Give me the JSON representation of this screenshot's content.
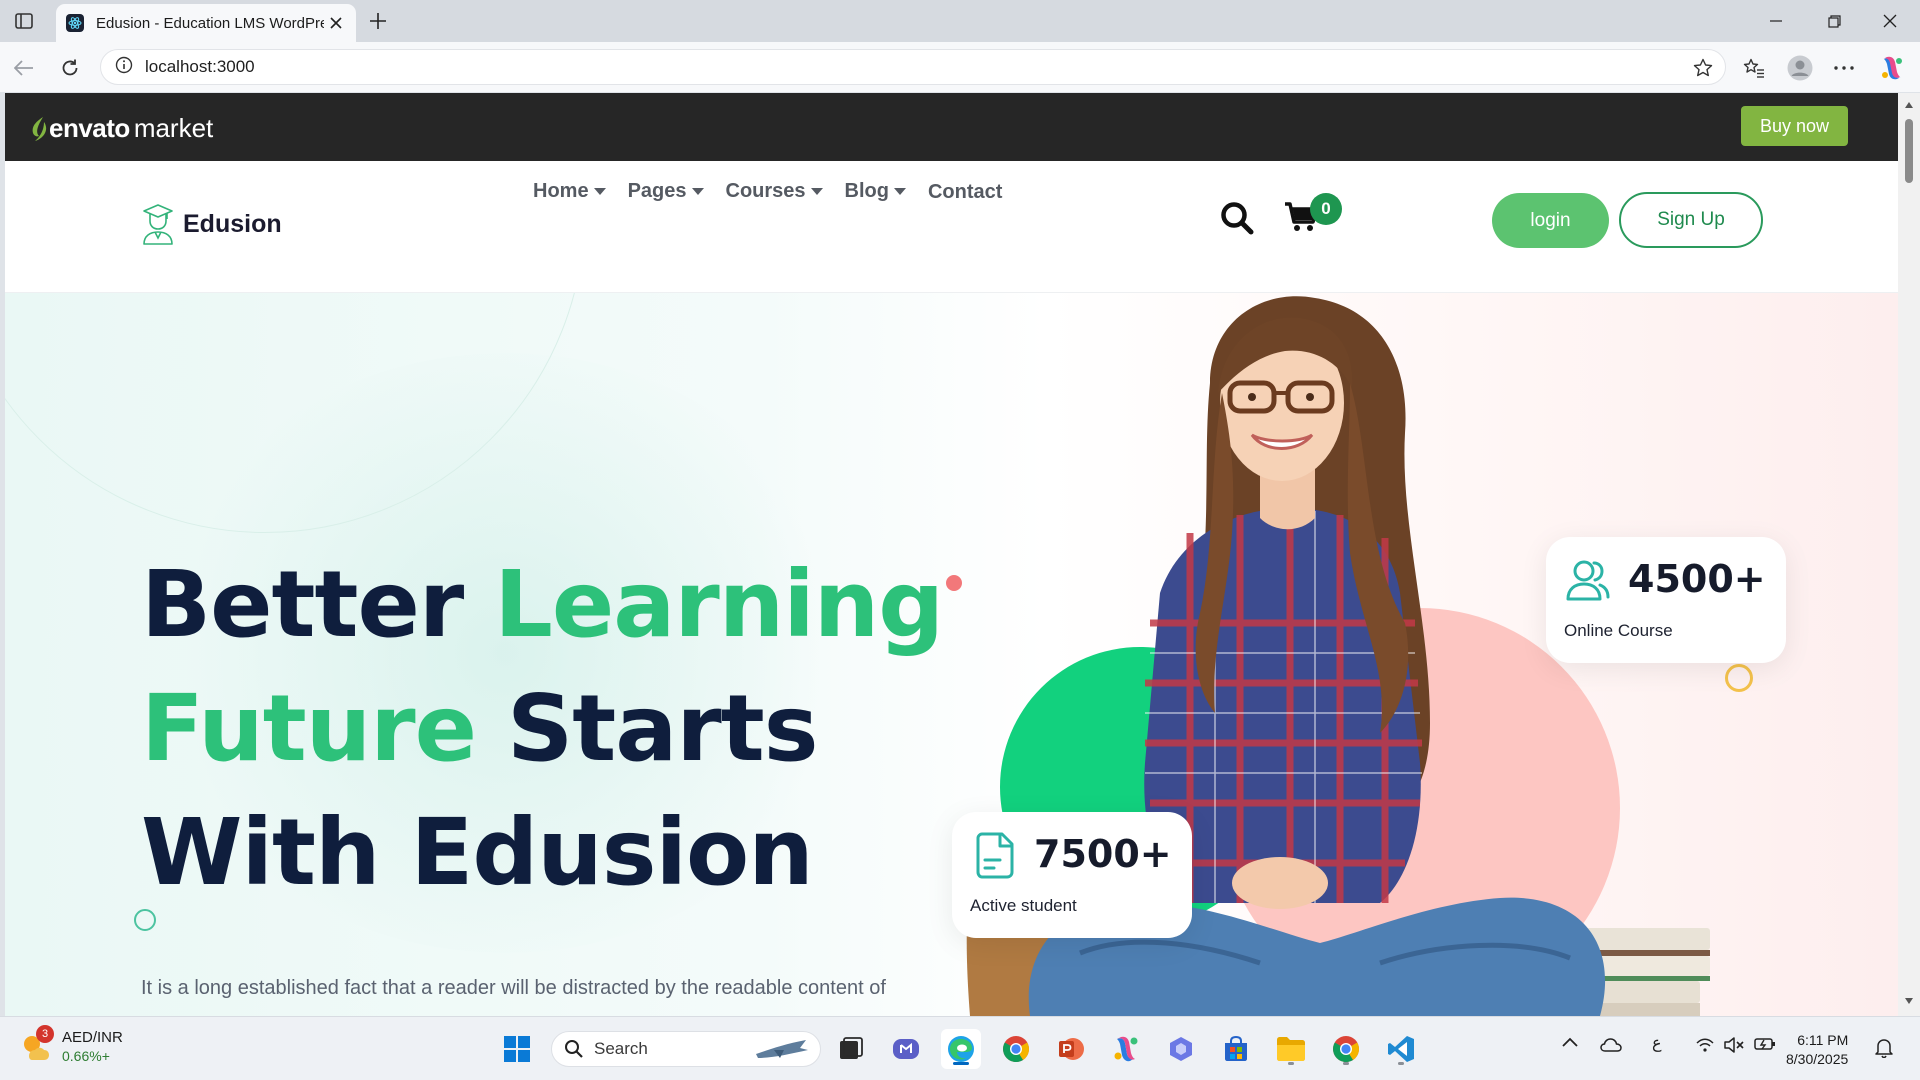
{
  "browser": {
    "tab_title": "Edusion - Education LMS WordPress Theme",
    "url": "localhost:3000"
  },
  "envato": {
    "logo_envato": "envato",
    "logo_market": "market",
    "buy_now": "Buy now"
  },
  "header": {
    "brand": "Edusion",
    "nav": [
      {
        "label": "Home",
        "dropdown": true
      },
      {
        "label": "Pages",
        "dropdown": true
      },
      {
        "label": "Courses",
        "dropdown": true
      },
      {
        "label": "Blog",
        "dropdown": true
      },
      {
        "label": "Contact",
        "dropdown": false
      }
    ],
    "cart_count": "0",
    "login": "login",
    "signup": "Sign Up"
  },
  "hero": {
    "title_line1_a": "Better ",
    "title_line1_b": "Learning",
    "title_line2_a": "Future",
    "title_line2_b": " Starts",
    "title_line3": "With Edusion",
    "subtitle": "It is a long established fact that a reader will be distracted by the readable content of"
  },
  "stats": {
    "active_num": "7500+",
    "active_label": "Active student",
    "online_num": "4500+",
    "online_label": "Online Course"
  },
  "taskbar": {
    "widget_badge": "3",
    "widget_title": "AED/INR",
    "widget_value": "0.66%+",
    "search_placeholder": "Search",
    "lang": "ع",
    "time": "6:11 PM",
    "date": "8/30/2025"
  },
  "colors": {
    "accent_green": "#2dc17a",
    "navy": "#0f1e3d",
    "envato_green": "#82b541",
    "login_green": "#5cc370"
  }
}
